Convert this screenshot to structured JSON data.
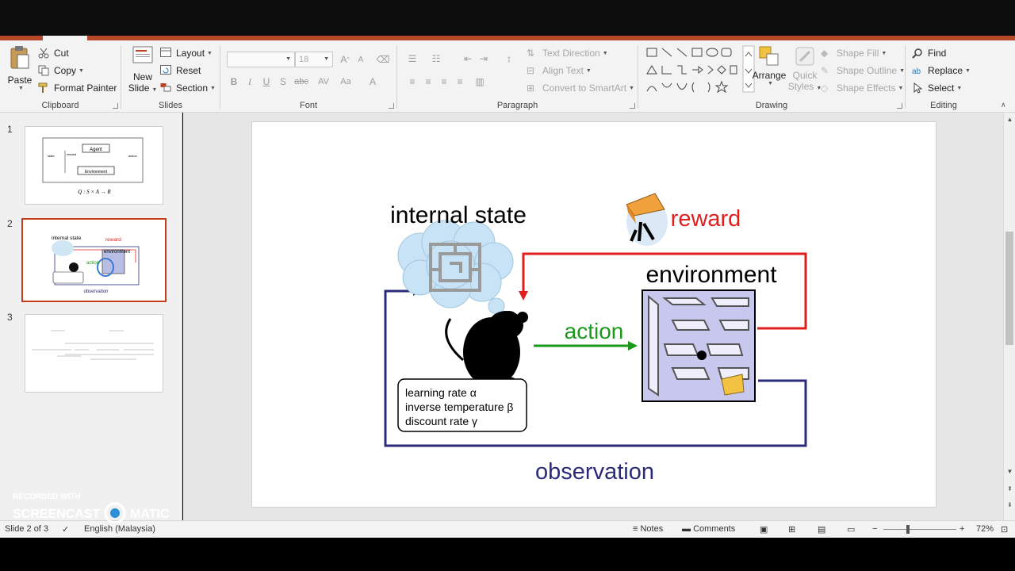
{
  "ribbon": {
    "clipboard": {
      "paste": "Paste",
      "cut": "Cut",
      "copy": "Copy",
      "format_painter": "Format Painter",
      "label": "Clipboard"
    },
    "slides": {
      "new_slide_1": "New",
      "new_slide_2": "Slide",
      "layout": "Layout",
      "reset": "Reset",
      "section": "Section",
      "label": "Slides"
    },
    "font": {
      "font_size": "18",
      "bold": "B",
      "italic": "I",
      "underline": "U",
      "shadow": "S",
      "strike": "abc",
      "spacing": "AV",
      "case": "Aa",
      "color": "A",
      "grow": "A",
      "shrink": "A",
      "label": "Font"
    },
    "paragraph": {
      "text_direction": "Text Direction",
      "align_text": "Align Text",
      "convert_smartart": "Convert to SmartArt",
      "label": "Paragraph"
    },
    "drawing": {
      "arrange": "Arrange",
      "quick_styles_1": "Quick",
      "quick_styles_2": "Styles",
      "shape_fill": "Shape Fill",
      "shape_outline": "Shape Outline",
      "shape_effects": "Shape Effects",
      "label": "Drawing"
    },
    "editing": {
      "find": "Find",
      "replace": "Replace",
      "select": "Select",
      "label": "Editing"
    }
  },
  "thumbnails": [
    {
      "number": "1",
      "agent": "Agent",
      "environment": "Environment",
      "state": "state",
      "reward": "reward",
      "action": "action",
      "formula": "Q : S × A → R"
    },
    {
      "number": "2",
      "internal_state": "internal state",
      "reward": "reward",
      "environment": "environment",
      "action": "action",
      "observation": "observation"
    },
    {
      "number": "3"
    }
  ],
  "slide": {
    "internal_state": "internal state",
    "reward": "reward",
    "environment": "environment",
    "action": "action",
    "observation": "observation",
    "params": [
      "learning rate α",
      "inverse temperature β",
      "discount rate γ"
    ]
  },
  "colors": {
    "reward": "#e01e1e",
    "action": "#1a9a1a",
    "observation": "#2b2b7a",
    "accent": "#b7472a",
    "active_thumb": "#c43e1c"
  },
  "status": {
    "slide_indicator": "Slide 2 of 3",
    "language": "English (Malaysia)",
    "notes": "Notes",
    "comments": "Comments",
    "zoom": "72%",
    "minus": "−",
    "plus": "+"
  },
  "watermark": {
    "line1": "RECORDED WITH",
    "line2a": "SCREENCAST",
    "line2b": "MATIC"
  }
}
